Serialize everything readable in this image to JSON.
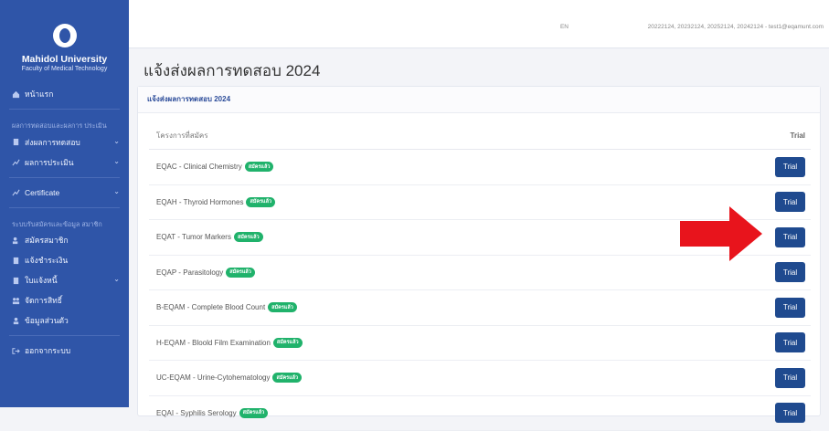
{
  "sidebar": {
    "brand_name": "Mahidol University",
    "brand_sub": "Faculty of Medical Technology",
    "items": {
      "home": "หน้าแรก",
      "section_report": "ผลการทดสอบและผลการ ประเมิน",
      "submit_results": "ส่งผลการทดสอบ",
      "evaluation": "ผลการประเมิน",
      "certificate": "Certificate",
      "section_member": "ระบบรับสมัครและข้อมูล สมาชิก",
      "register": "สมัครสมาชิก",
      "payment": "แจ้งชำระเงิน",
      "invoice": "ใบแจ้งหนี้",
      "permissions": "จัดการสิทธิ์",
      "profile": "ข้อมูลส่วนตัว",
      "logout": "ออกจากระบบ"
    }
  },
  "topbar": {
    "lang": "EN",
    "user": "20222124, 20232124, 20252124, 20242124 - test1@eqamunt.com"
  },
  "page": {
    "title": "แจ้งส่งผลการทดสอบ 2024",
    "card_title": "แจ้งส่งผลการทดสอบ 2024"
  },
  "table": {
    "col_program": "โครงการที่สมัคร",
    "col_trial": "Trial",
    "badge": "สมัครแล้ว",
    "button": "Trial",
    "rows": [
      "EQAC - Clinical Chemistry",
      "EQAH - Thyroid Hormones",
      "EQAT - Tumor Markers",
      "EQAP - Parasitology",
      "B-EQAM - Complete Blood Count",
      "H-EQAM - Bloold Film Examination",
      "UC-EQAM - Urine-Cytohematology",
      "EQAI - Syphilis Serology"
    ]
  },
  "colors": {
    "sidebar": "#2f55a8",
    "button": "#1f4a8f",
    "badge": "#20b26b",
    "arrow": "#e8141c"
  }
}
